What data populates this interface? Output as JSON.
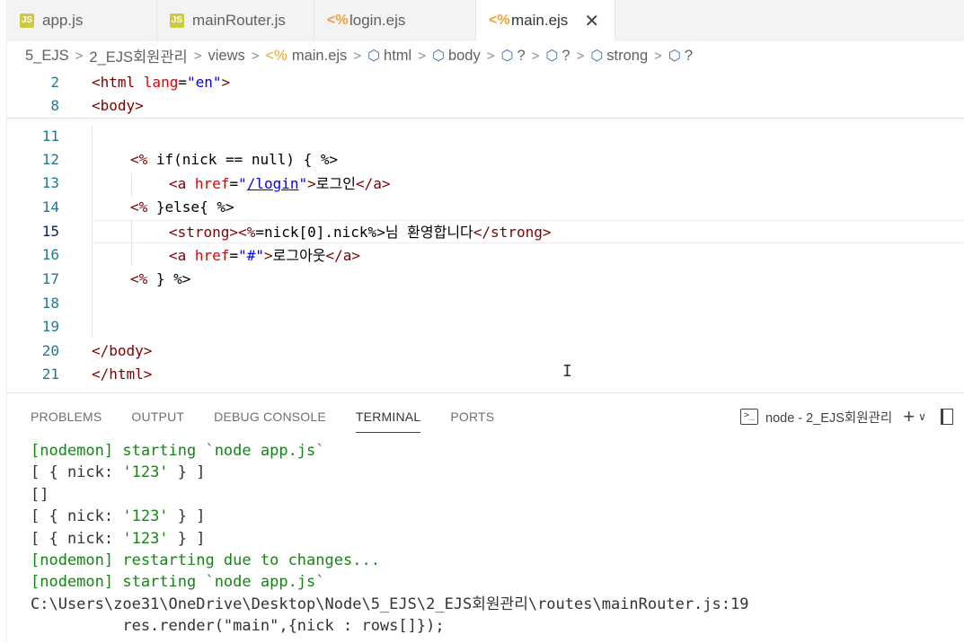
{
  "tabs": [
    {
      "icon": "JS",
      "label": "app.js"
    },
    {
      "icon": "JS",
      "label": "mainRouter.js"
    },
    {
      "icon": "<%",
      "label": "login.ejs"
    },
    {
      "icon": "<%",
      "label": "main.ejs",
      "close": "✕"
    }
  ],
  "breadcrumb": {
    "items": [
      "5_EJS",
      "2_EJS회원관리",
      "views",
      "main.ejs",
      "html",
      "body",
      "?",
      "?",
      "strong",
      "?"
    ],
    "separator": ">"
  },
  "editor": {
    "lines": [
      {
        "n": "2",
        "text": "<html lang=\"en\">"
      },
      {
        "n": "8",
        "text": "<body>"
      },
      {
        "n": "11",
        "text": ""
      },
      {
        "n": "12",
        "text": "<% if(nick == null) { %>"
      },
      {
        "n": "13",
        "text": "<a href=\"/login\">로그인</a>"
      },
      {
        "n": "14",
        "text": "<% }else{ %>"
      },
      {
        "n": "15",
        "text": "<strong><%=nick[0].nick%>님 환영합니다</strong>"
      },
      {
        "n": "16",
        "text": "<a href=\"#\">로그아웃</a>"
      },
      {
        "n": "17",
        "text": "<% } %>"
      },
      {
        "n": "18",
        "text": ""
      },
      {
        "n": "19",
        "text": ""
      },
      {
        "n": "20",
        "text": "</body>"
      },
      {
        "n": "21",
        "text": "</html>"
      }
    ],
    "current_line": "15"
  },
  "panel": {
    "tabs": [
      "PROBLEMS",
      "OUTPUT",
      "DEBUG CONSOLE",
      "TERMINAL",
      "PORTS"
    ],
    "active_tab": "TERMINAL",
    "terminal_name": "node - 2_EJS회원관리",
    "terminal_icon": ">_",
    "add_symbol": "+",
    "dropdown_symbol": "∨",
    "output": [
      "[nodemon] starting `node app.js`",
      "[ { nick: '123' } ]",
      "[]",
      "[ { nick: '123' } ]",
      "[ { nick: '123' } ]",
      "[nodemon] restarting due to changes...",
      "[nodemon] starting `node app.js`",
      "C:\\Users\\zoe31\\OneDrive\\Desktop\\Node\\5_EJS\\2_EJS회원관리\\routes\\mainRouter.js:19",
      "          res.render(\"main\",{nick : rows[]});"
    ]
  },
  "colors": {
    "tag": "#800000",
    "attr": "#e50000",
    "string": "#0000ff",
    "line_number": "#237893",
    "terminal_green": "#178317",
    "js_icon": "#cbcb41",
    "ejs_icon": "#e8a33d"
  }
}
